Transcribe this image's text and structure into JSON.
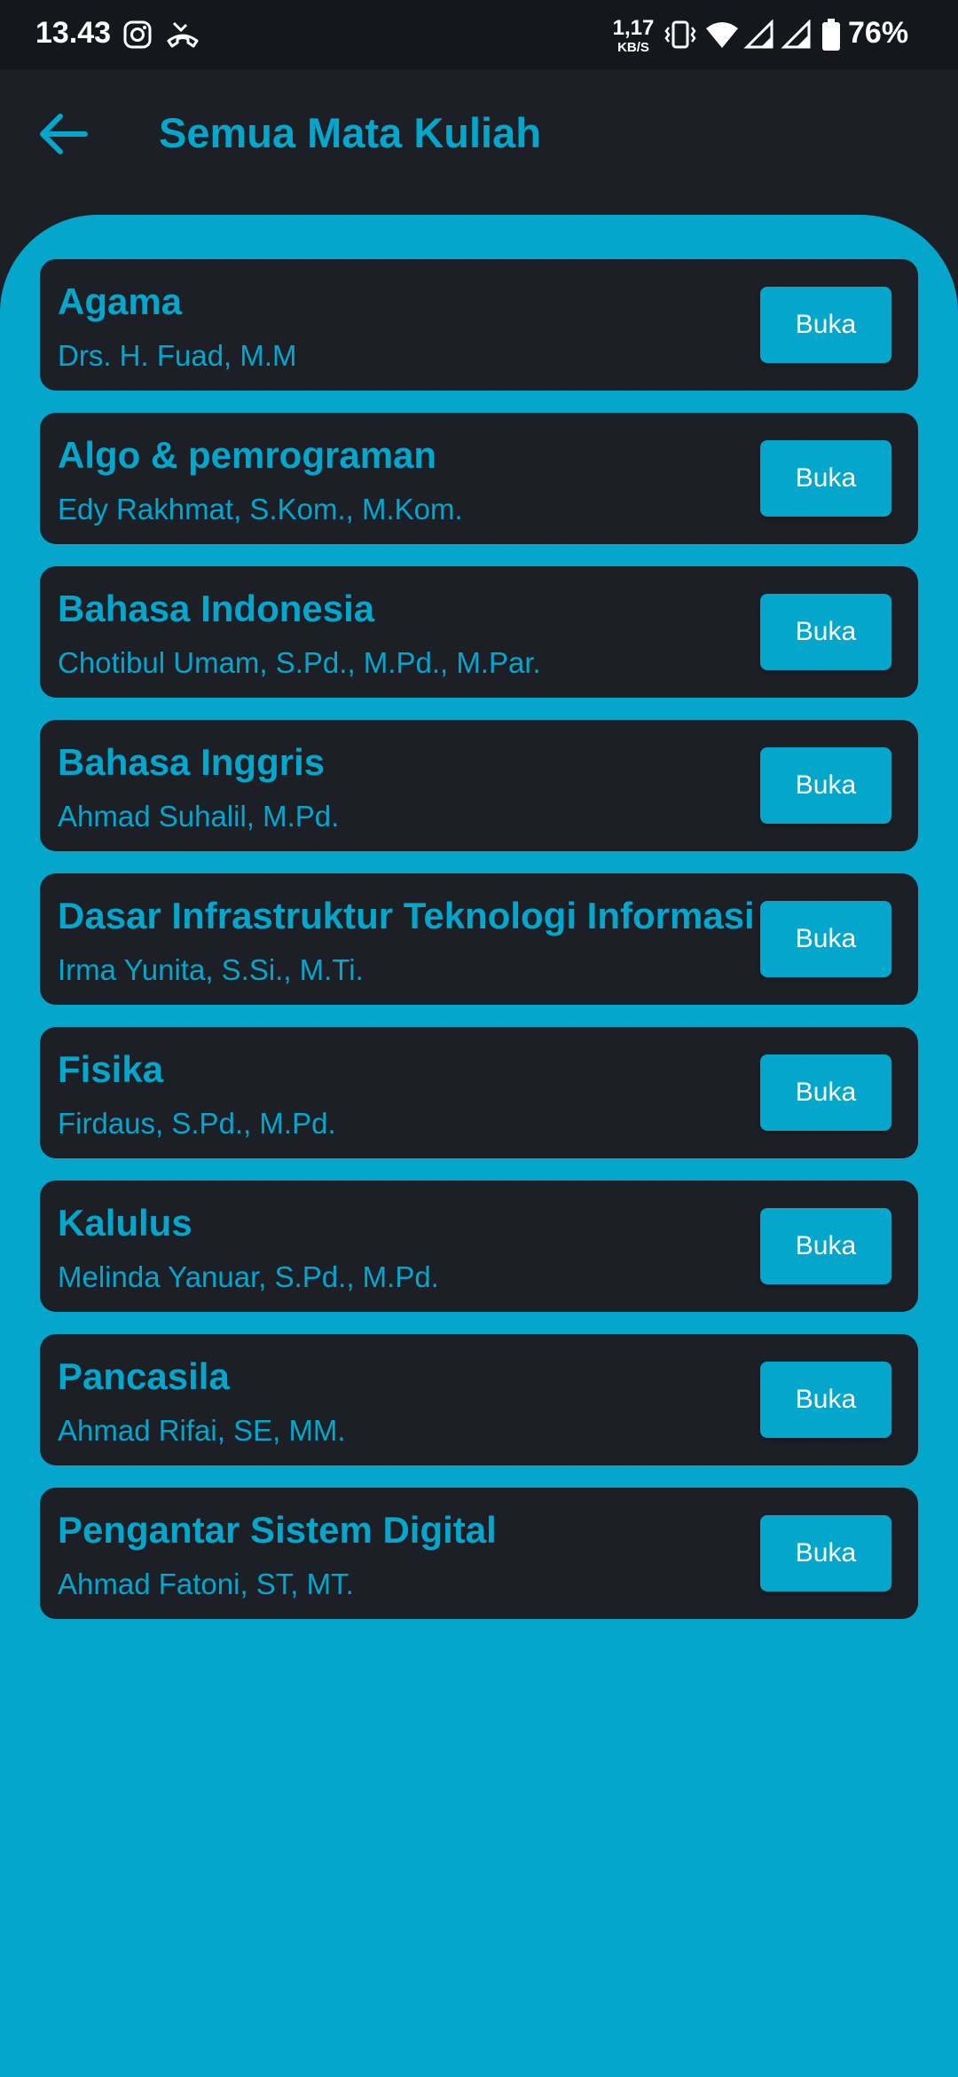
{
  "status_bar": {
    "time": "13.43",
    "net_speed_value": "1,17",
    "net_speed_unit": "KB/S",
    "battery": "76%",
    "icons": [
      "instagram-icon",
      "missed-call-icon",
      "vibrate-icon",
      "wifi-icon",
      "signal-icon",
      "signal-icon",
      "battery-icon"
    ]
  },
  "app_bar": {
    "title": "Semua Mata Kuliah",
    "back_icon": "arrow-left-icon"
  },
  "colors": {
    "accent": "#04a6cc",
    "card_bg": "#1c2026",
    "app_bg": "#1c2026",
    "status_bg": "#14171b"
  },
  "courses": [
    {
      "name": "Agama",
      "lecturer": "Drs. H. Fuad, M.M",
      "button": "Buka"
    },
    {
      "name": "Algo & pemrograman",
      "lecturer": "Edy Rakhmat, S.Kom., M.Kom.",
      "button": "Buka"
    },
    {
      "name": "Bahasa Indonesia",
      "lecturer": "Chotibul Umam, S.Pd., M.Pd., M.Par.",
      "button": "Buka"
    },
    {
      "name": "Bahasa Inggris",
      "lecturer": "Ahmad Suhalil, M.Pd.",
      "button": "Buka"
    },
    {
      "name": "Dasar Infrastruktur Teknologi Informasi",
      "lecturer": "Irma Yunita, S.Si., M.Ti.",
      "button": "Buka"
    },
    {
      "name": "Fisika",
      "lecturer": "Firdaus, S.Pd., M.Pd.",
      "button": "Buka"
    },
    {
      "name": "Kalulus",
      "lecturer": "Melinda Yanuar, S.Pd., M.Pd.",
      "button": "Buka"
    },
    {
      "name": "Pancasila",
      "lecturer": "Ahmad Rifai, SE, MM.",
      "button": "Buka"
    },
    {
      "name": "Pengantar Sistem Digital",
      "lecturer": "Ahmad Fatoni, ST, MT.",
      "button": "Buka"
    }
  ]
}
